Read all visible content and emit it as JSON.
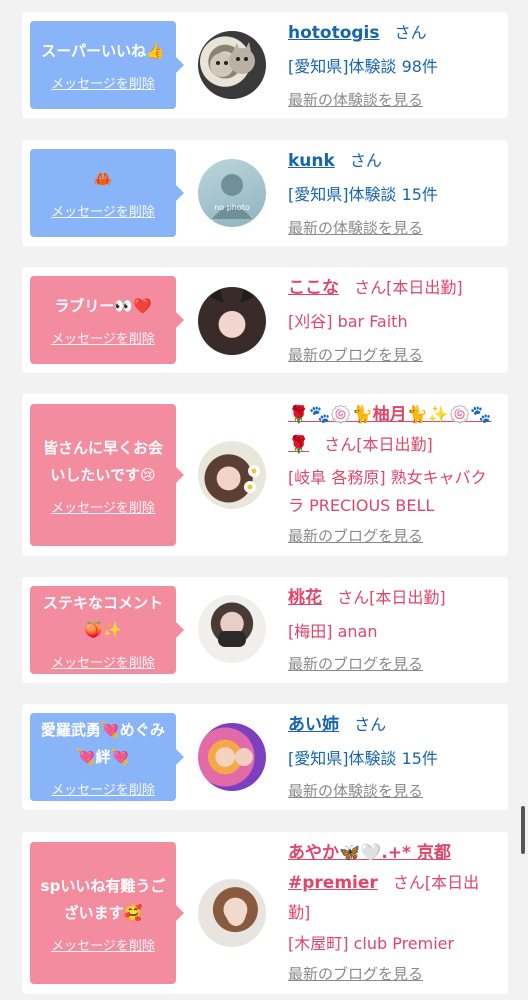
{
  "items": [
    {
      "bubble_color": "blue",
      "message": "スーパーいいね👍",
      "delete_label": "メッセージを削除",
      "name": "hototogis",
      "san": "さん",
      "detail": "[愛知県]体験談 98件",
      "see_more": "最新の体験談を見る",
      "avatar_icon": "cat-photo-avatar"
    },
    {
      "bubble_color": "blue",
      "message": "🦀",
      "delete_label": "メッセージを削除",
      "name": "kunk",
      "san": "さん",
      "detail": "[愛知県]体験談 15件",
      "see_more": "最新の体験談を見る",
      "avatar_icon": "no-photo-avatar",
      "avatar_text": "no photo"
    },
    {
      "bubble_color": "pink",
      "message": "ラブリー👀❤️",
      "delete_label": "メッセージを削除",
      "name": "ここな",
      "san": "さん[本日出勤]",
      "detail": "[刈谷] bar Faith",
      "see_more": "最新のブログを見る",
      "avatar_icon": "girl-photo-avatar"
    },
    {
      "bubble_color": "pink",
      "message": "皆さんに早くお会いしたいです😢",
      "delete_label": "メッセージを削除",
      "name": "🌹🐾🍥🐈柚月🐈✨🍥🐾🌹",
      "san": "さん[本日出勤]",
      "detail": "[岐阜 各務原] 熟女キャバクラ PRECIOUS BELL",
      "see_more": "最新のブログを見る",
      "avatar_icon": "girl-photo-avatar"
    },
    {
      "bubble_color": "pink",
      "message": "ステキなコメント🍑✨",
      "delete_label": "メッセージを削除",
      "name": "桃花",
      "san": "さん[本日出勤]",
      "detail": "[梅田] anan",
      "see_more": "最新のブログを見る",
      "avatar_icon": "girl-photo-avatar"
    },
    {
      "bubble_color": "blue",
      "message": "愛羅武勇💘めぐみ💘絆💘",
      "delete_label": "メッセージを削除",
      "name": "あい姉",
      "san": "さん",
      "detail": "[愛知県]体験談 15件",
      "see_more": "最新の体験談を見る",
      "avatar_icon": "girls-photo-avatar"
    },
    {
      "bubble_color": "pink",
      "message": "spいいね有難うございます🥰",
      "delete_label": "メッセージを削除",
      "name": "あやか🦋🤍.+* 京都 #premier",
      "san": "さん[本日出勤]",
      "detail": "[木屋町] club Premier",
      "see_more": "最新のブログを見る",
      "avatar_icon": "girl-photo-avatar"
    }
  ],
  "colors": {
    "blue_bubble": "#8ab4f8",
    "pink_bubble": "#f48ca0",
    "link_blue": "#1565b0",
    "link_pink": "#e0456a",
    "muted": "#8a8a8a"
  }
}
